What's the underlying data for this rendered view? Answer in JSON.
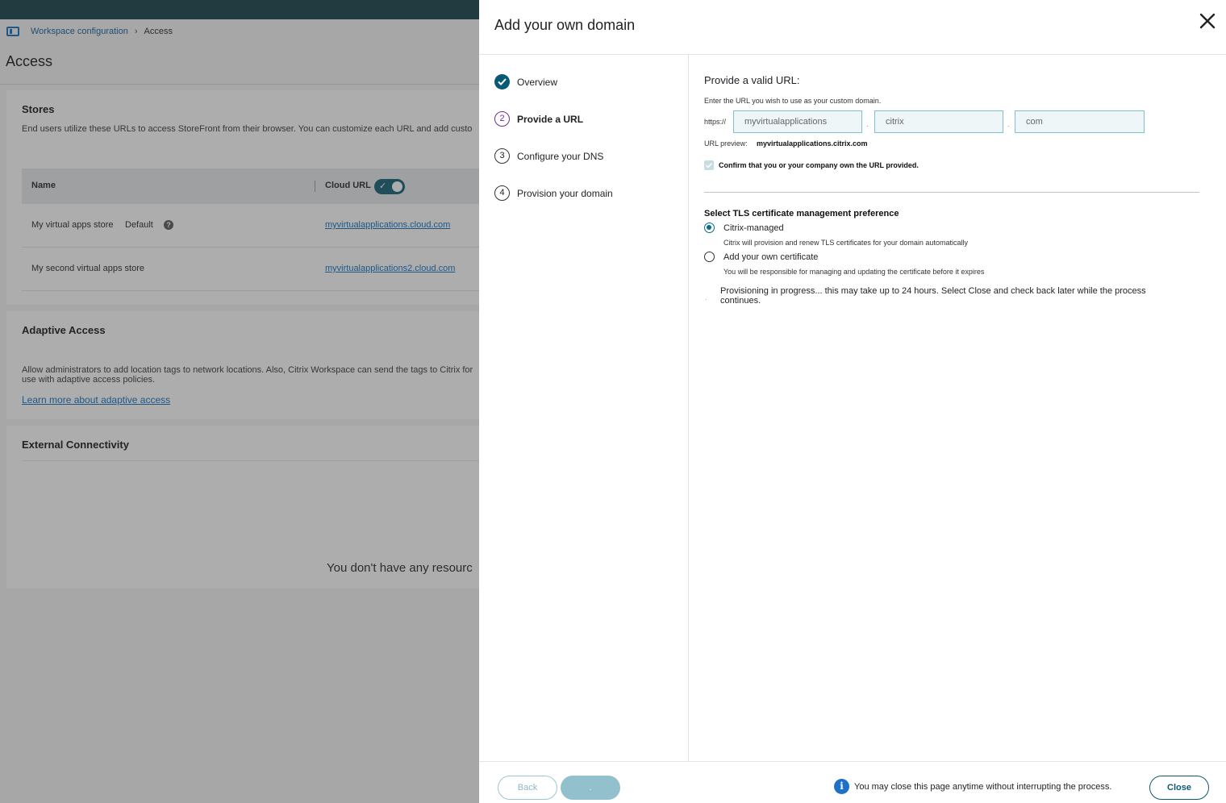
{
  "background": {
    "breadcrumb": {
      "parent": "Workspace configuration",
      "separator": "›",
      "current": "Access"
    },
    "page_title": "Access",
    "stores": {
      "title": "Stores",
      "description": "End users utilize these URLs to access StoreFront from their browser. You can customize each URL and add custo",
      "columns": {
        "name": "Name",
        "cloud_url": "Cloud URL"
      },
      "rows": [
        {
          "name": "My virtual apps store",
          "badge": "Default",
          "help": "?",
          "url": "myvirtualapplications.cloud.com"
        },
        {
          "name": "My second virtual apps store",
          "url": "myvirtualapplications2.cloud.com"
        }
      ]
    },
    "adaptive_access": {
      "title": "Adaptive Access",
      "description": "Allow administrators to add location tags to network locations. Also, Citrix Workspace can send the tags to Citrix for use with adaptive access policies.",
      "link": "Learn more about adaptive access"
    },
    "external_connectivity": {
      "title": "External Connectivity",
      "empty_message": "You don't have any resourc"
    }
  },
  "drawer": {
    "title": "Add your own domain",
    "steps": [
      {
        "number": "1",
        "label": "Overview",
        "state": "done"
      },
      {
        "number": "2",
        "label": "Provide a URL",
        "state": "active"
      },
      {
        "number": "3",
        "label": "Configure your DNS",
        "state": "pending"
      },
      {
        "number": "4",
        "label": "Provision your domain",
        "state": "pending"
      }
    ],
    "url_section": {
      "title": "Provide a valid URL:",
      "hint": "Enter the URL you wish to use as your custom domain.",
      "prefix": "https://",
      "parts": [
        "myvirtualapplications",
        "citrix",
        "com"
      ],
      "separator": ".",
      "preview_label": "URL preview:",
      "preview_value": "myvirtualapplications.citrix.com",
      "confirm_label": "Confirm that you or your company own the URL provided.",
      "confirm_checked": true
    },
    "tls": {
      "title": "Select TLS certificate management preference",
      "options": [
        {
          "label": "Citrix-managed",
          "description": "Citrix will provision and renew TLS certificates for your domain automatically",
          "selected": true
        },
        {
          "label": "Add your own certificate",
          "description": "You will be responsible for managing and updating the certificate before it expires",
          "selected": false
        }
      ],
      "bullet": ".",
      "provisioning_message": "Provisioning in progress... this may take up to 24 hours. Select Close and check back later while the process continues."
    },
    "footer": {
      "back_label": "Back",
      "next_label": ".",
      "info_icon": "i",
      "info_text": "You may close this page anytime without interrupting the process.",
      "close_label": "Close"
    }
  },
  "colors": {
    "topbar": "#0f3b44",
    "primary": "#0b5a70",
    "active_step": "#6c2ba0",
    "link": "#0b6bbf",
    "info": "#1f71c8"
  }
}
